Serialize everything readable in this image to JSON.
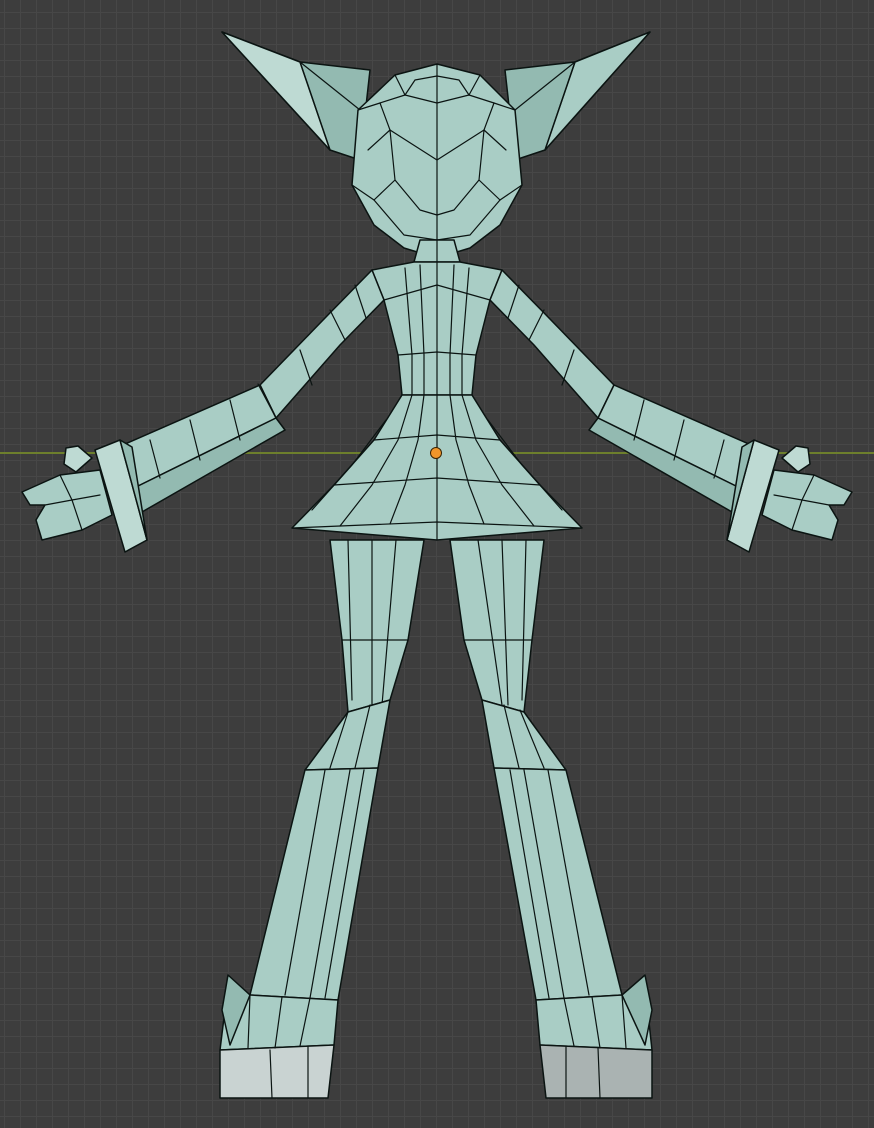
{
  "viewport": {
    "view": "front-orthographic",
    "grid_color": "#474747",
    "background_color": "#3d3d3d",
    "horizon_axis_color": "#6d7f2c"
  },
  "object": {
    "mesh_color": "#a9cdc5",
    "edge_color": "#0b1412",
    "origin_color": "#f0962a",
    "shading": "solid-with-wireframe"
  }
}
